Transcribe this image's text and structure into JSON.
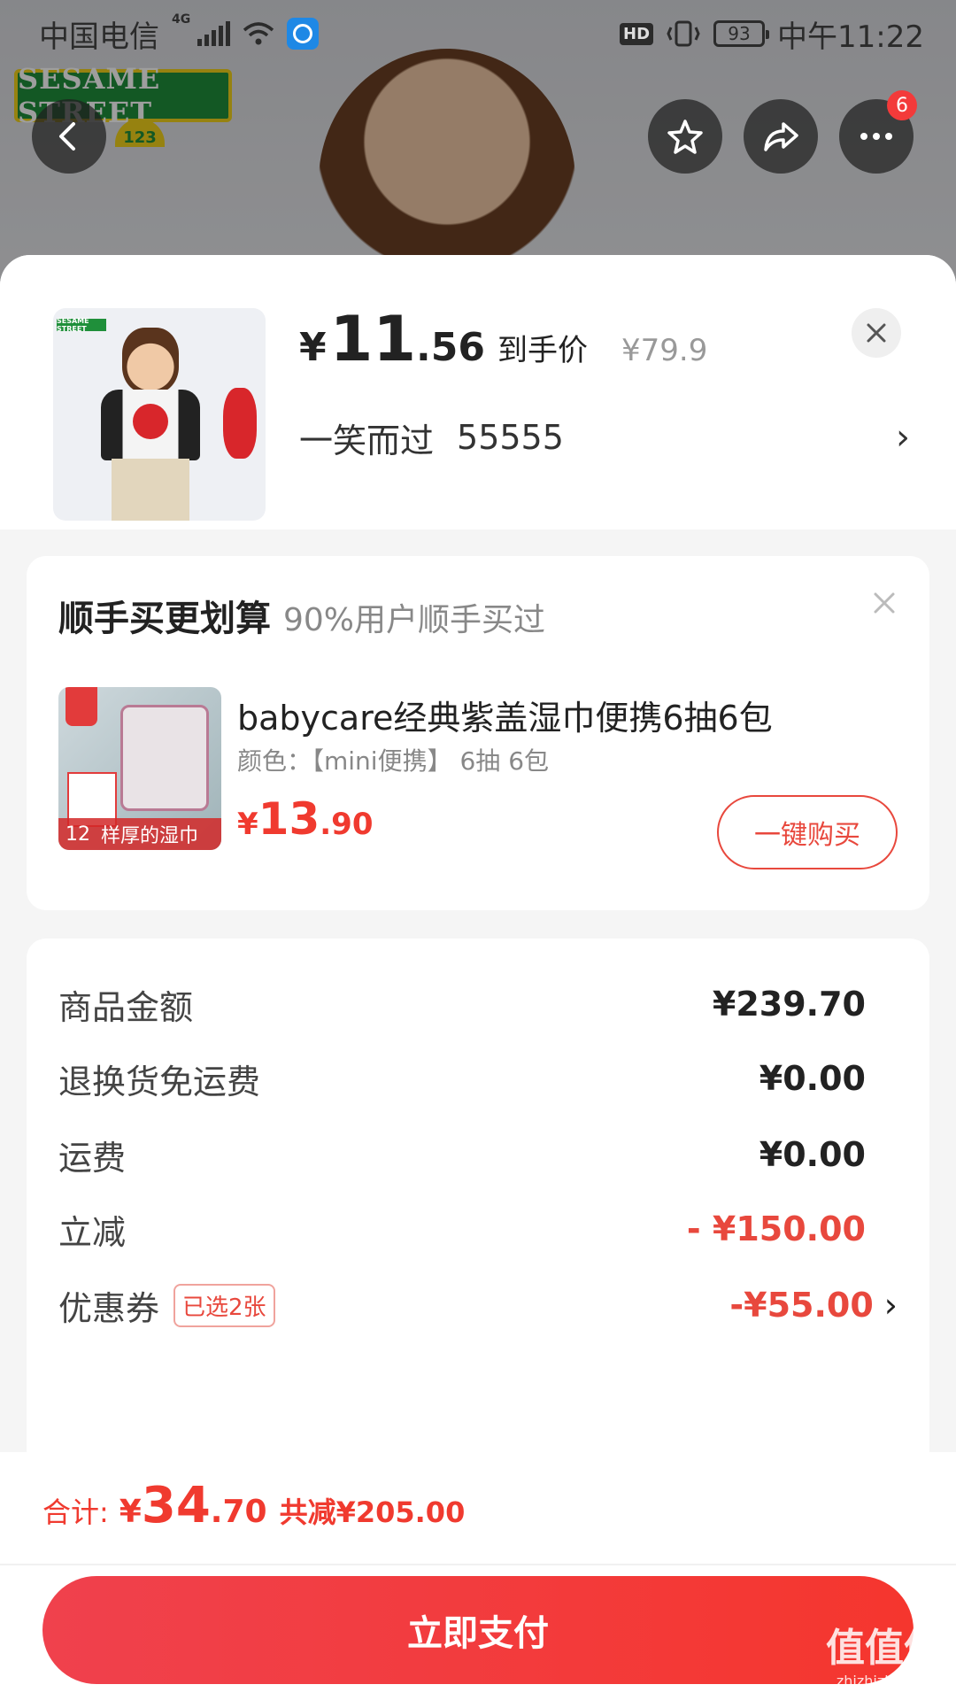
{
  "status_bar": {
    "carrier": "中国电信",
    "network": "4G",
    "battery": "93",
    "time": "中午11:22",
    "hd": "HD"
  },
  "background": {
    "brand_logo": "SESAME STREET",
    "brand_number": "123"
  },
  "header": {
    "more_badge": "6",
    "icons": [
      "back-icon",
      "star-icon",
      "share-icon",
      "more-icon"
    ]
  },
  "product": {
    "price_yen": "¥",
    "price_int": "11",
    "price_dec": ".56",
    "price_label": "到手价",
    "original_price": "¥79.9",
    "variant": "一笑而过",
    "variant_code": "55555",
    "thumb_tag": "SESAME STREET"
  },
  "addon": {
    "title": "顺手买更划算",
    "subtitle": "90%用户顺手买过",
    "item_name": "babycare经典紫盖湿巾便携6抽6包",
    "item_spec": "颜色：【mini便携】 6抽 6包",
    "price_yen": "¥",
    "price_int": "13",
    "price_dec": ".90",
    "buy_label": "一键购买",
    "thumb_price": "12",
    "thumb_banner": "样厚的湿巾"
  },
  "summary": {
    "rows": [
      {
        "label": "商品金额",
        "value": "¥239.70"
      },
      {
        "label": "退换货免运费",
        "value": "¥0.00"
      },
      {
        "label": "运费",
        "value": "¥0.00"
      },
      {
        "label": "立减",
        "value": "- ¥150.00"
      },
      {
        "label": "优惠券",
        "tag": "已选2张",
        "value": "-¥55.00"
      }
    ]
  },
  "footer": {
    "total_label": "合计:",
    "total_yen": "¥",
    "total_int": "34",
    "total_dec": ".70",
    "total_save": "共减¥205.00",
    "pay_label": "立即支付"
  },
  "watermark": {
    "main": "值值值",
    "sub": "zhizhizhi.com"
  },
  "colors": {
    "accent_red": "#f03a2f",
    "pay_button": "#f5362e"
  }
}
